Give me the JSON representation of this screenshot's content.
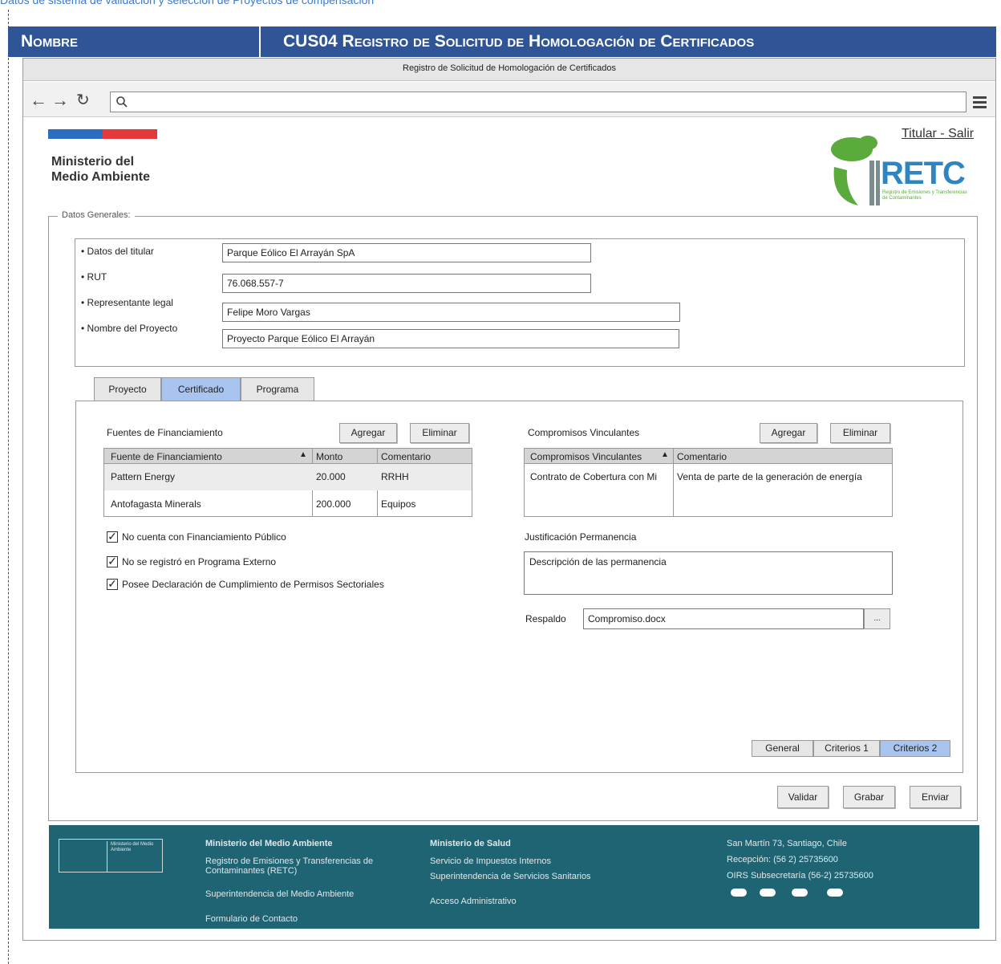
{
  "caption": "Datos de sistema de validación y selección de Proyectos de compensación",
  "header": {
    "nombre_label": "Nombre",
    "title": "CUS04 Registro de Solicitud de Homologación de Certificados"
  },
  "browser": {
    "window_title": "Registro de Solicitud de Homologación de Certificados"
  },
  "brand": {
    "ministry_name": "Ministerio del Medio Ambiente",
    "logo_text": "RETC",
    "logo_subtitle": "Registro de Emisiones y Transferencias de Contaminantes",
    "user_links": "Titular - Salir"
  },
  "general": {
    "legend": "Datos Generales:",
    "titular_label": "• Datos del titular",
    "titular_value": "Parque Eólico El Arrayán SpA",
    "rut_label": "• RUT",
    "rut_value": "76.068.557-7",
    "rep_label": "• Representante legal",
    "rep_value": "Felipe Moro Vargas",
    "project_label": "• Nombre del Proyecto",
    "project_value": "Proyecto Parque Eólico El Arrayán"
  },
  "tabs": [
    "Proyecto",
    "Certificado",
    "Programa"
  ],
  "financing": {
    "title": "Fuentes de Financiamiento",
    "add": "Agregar",
    "remove": "Eliminar",
    "headers": [
      "Fuente de Financiamiento",
      "Monto",
      "Comentario"
    ],
    "rows": [
      [
        "Pattern Energy",
        "20.000",
        "RRHH"
      ],
      [
        "Antofagasta Minerals",
        "200.000",
        "Equipos"
      ]
    ]
  },
  "checkboxes": [
    "No cuenta con Financiamiento Público",
    "No se registró en Programa Externo",
    "Posee Declaración de Cumplimiento de Permisos Sectoriales"
  ],
  "commitments": {
    "title": "Compromisos Vinculantes",
    "add": "Agregar",
    "remove": "Eliminar",
    "headers": [
      "Compromisos Vinculantes",
      "Comentario"
    ],
    "rows": [
      [
        "Contrato de Cobertura con Mi",
        "Venta de parte de la generación de energía"
      ]
    ]
  },
  "justification": {
    "label": "Justificación Permanencia",
    "value": "Descripción de las permanencia"
  },
  "respaldo": {
    "label": "Respaldo",
    "value": "Compromiso.docx",
    "browse": "..."
  },
  "subtabs": [
    "General",
    "Criterios 1",
    "Criterios 2"
  ],
  "actions": {
    "validar": "Validar",
    "grabar": "Grabar",
    "enviar": "Enviar"
  },
  "footer": {
    "logo_text": "Ministerio del Medio Ambiente",
    "col1": [
      "Ministerio del Medio Ambiente",
      "Registro de Emisiones y Transferencias de Contaminantes (RETC)",
      "Superintendencia del Medio Ambiente",
      "Formulario de Contacto"
    ],
    "col2": [
      "Ministerio de Salud",
      "Servicio de Impuestos Internos",
      "Superintendencia de Servicios Sanitarios",
      "Acceso Administrativo"
    ],
    "col3": [
      "San Martín 73, Santiago, Chile",
      "Recepción: (56 2) 25735600",
      "OIRS Subsecretaría (56-2) 25735600"
    ]
  },
  "colors": {
    "header_bg": "#2f5597",
    "tab_active": "#a9c4ee",
    "footer_bg": "#1e6473",
    "logo_green": "#5aaa3c",
    "logo_blue": "#2e86c1"
  }
}
